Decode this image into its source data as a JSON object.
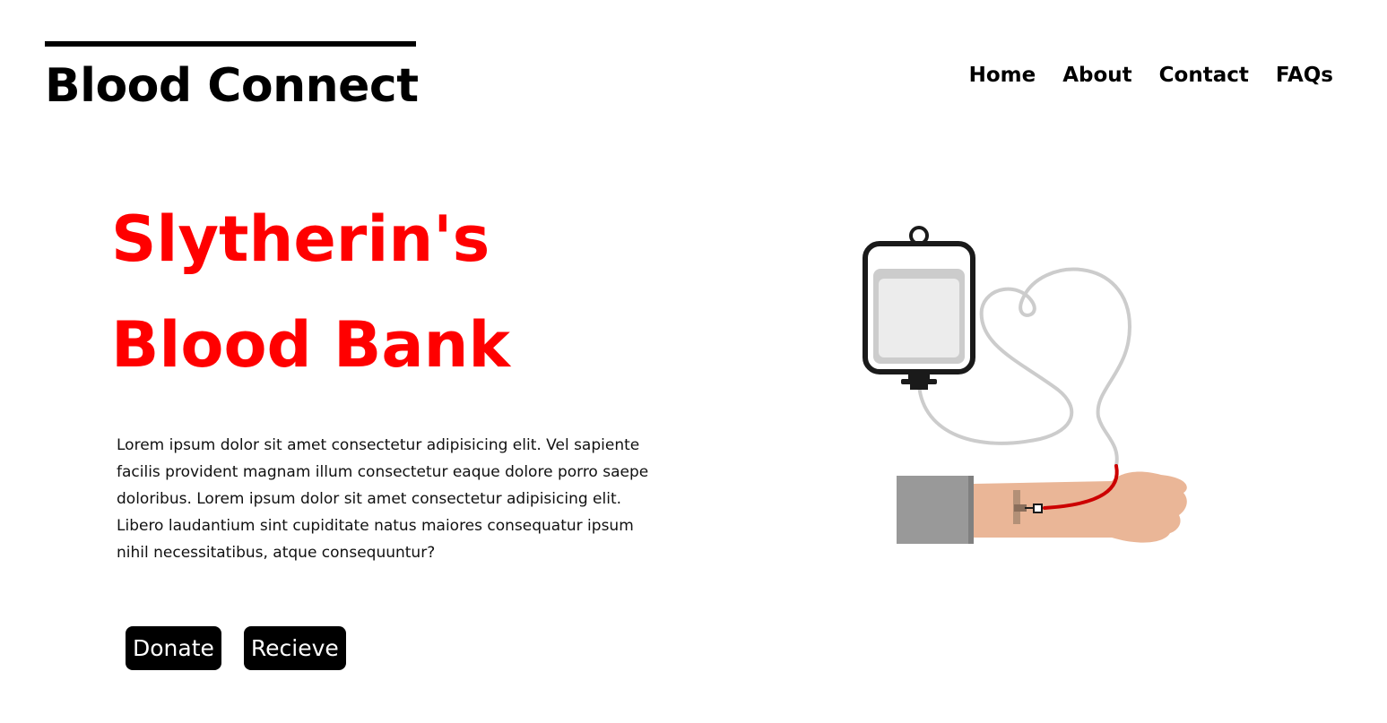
{
  "header": {
    "brand": "Blood Connect",
    "nav": [
      "Home",
      "About",
      "Contact",
      "FAQs"
    ]
  },
  "hero": {
    "title_line1": "Slytherin's",
    "title_line2": "Blood Bank",
    "description": "Lorem ipsum dolor sit amet consectetur adipisicing elit. Vel sapiente facilis provident magnam illum consectetur eaque dolore porro saepe doloribus. Lorem ipsum dolor sit amet consectetur adipisicing elit. Libero laudantium sint cupiditate natus maiores consequatur ipsum nihil necessitatibus, atque consequuntur?",
    "donate_label": "Donate",
    "recieve_label": "Recieve"
  },
  "colors": {
    "accent": "#ff0000",
    "button_bg": "#000000",
    "button_text": "#ffffff"
  },
  "icons": [
    "blood-bag-transfusion-icon"
  ]
}
